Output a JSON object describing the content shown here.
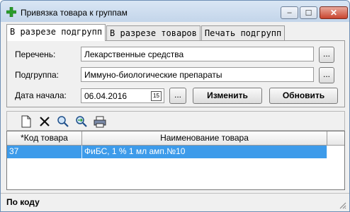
{
  "window": {
    "title": "Привязка товара к группам",
    "icon": "green-cross-icon",
    "controls": {
      "minimize": "–",
      "maximize": "☐",
      "close": "✕"
    }
  },
  "tabs": [
    {
      "label": "В разрезе подгрупп",
      "active": true
    },
    {
      "label": "В разрезе товаров",
      "active": false
    },
    {
      "label": "Печать подгрупп",
      "active": false
    }
  ],
  "form": {
    "list_label": "Перечень:",
    "list_value": "Лекарственные средства",
    "subgroup_label": "Подгруппа:",
    "subgroup_value": "Иммуно-биологические препараты",
    "start_date_label": "Дата начала:",
    "start_date_value": "06.04.2016",
    "calendar_glyph": "15",
    "browse_label": "...",
    "change_button": "Изменить",
    "refresh_button": "Обновить"
  },
  "toolbar": {
    "icons": [
      "new-document-icon",
      "delete-icon",
      "search-icon",
      "search-next-icon",
      "print-icon"
    ]
  },
  "table": {
    "columns": [
      "*Код товара",
      "Наименование товара"
    ],
    "rows": [
      {
        "code": "37",
        "name": "ФиБС, 1 % 1 мл амп.№10",
        "selected": true
      }
    ]
  },
  "status": {
    "text": "По коду"
  },
  "colors": {
    "selection": "#3d9bea",
    "accent": "#2a9d2a",
    "close": "#c9452f"
  }
}
